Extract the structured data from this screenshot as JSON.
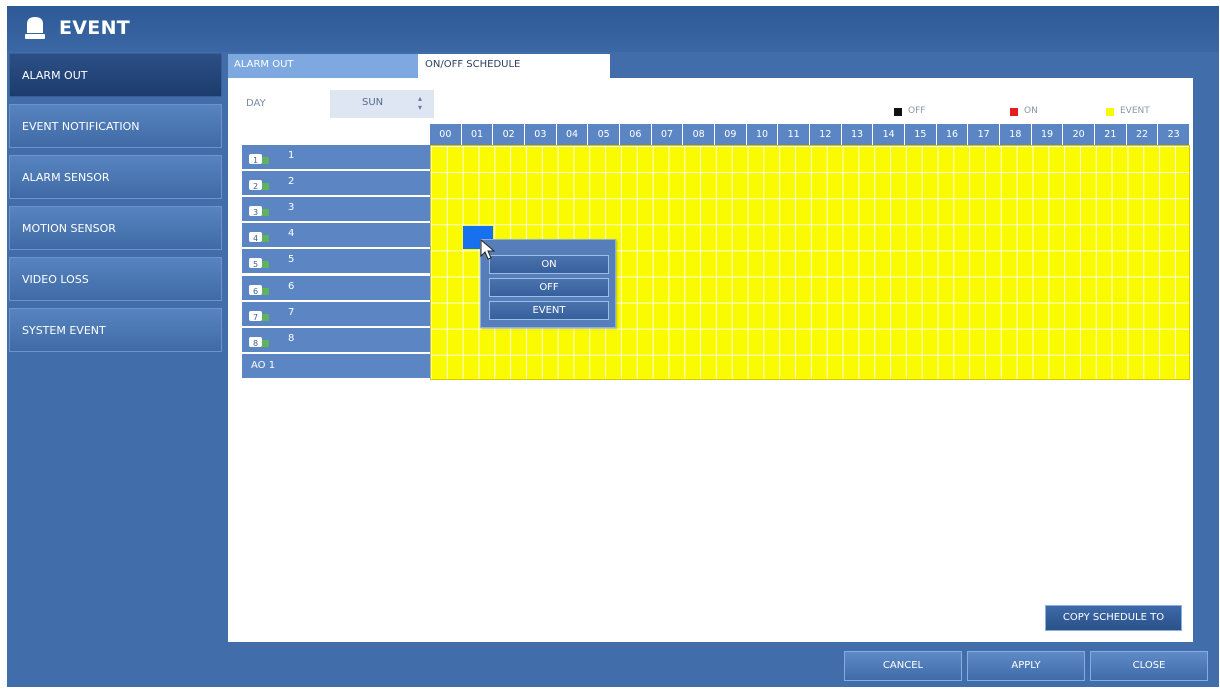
{
  "app": {
    "title": "EVENT"
  },
  "sidebar": {
    "items": [
      {
        "label": "ALARM OUT",
        "active": true
      },
      {
        "label": "EVENT NOTIFICATION",
        "active": false
      },
      {
        "label": "ALARM SENSOR",
        "active": false
      },
      {
        "label": "MOTION SENSOR",
        "active": false
      },
      {
        "label": "VIDEO LOSS",
        "active": false
      },
      {
        "label": "SYSTEM EVENT",
        "active": false
      }
    ]
  },
  "tabs": [
    {
      "label": "ALARM OUT",
      "active": false
    },
    {
      "label": "ON/OFF SCHEDULE",
      "active": true
    }
  ],
  "day": {
    "label": "DAY",
    "value": "SUN",
    "spinner": "▲▼"
  },
  "legend": [
    {
      "label": "OFF",
      "color": "#111111"
    },
    {
      "label": "ON",
      "color": "#e0201c"
    },
    {
      "label": "EVENT",
      "color": "#fafa00"
    }
  ],
  "hours": [
    "00",
    "01",
    "02",
    "03",
    "04",
    "05",
    "06",
    "07",
    "08",
    "09",
    "10",
    "11",
    "12",
    "13",
    "14",
    "15",
    "16",
    "17",
    "18",
    "19",
    "20",
    "21",
    "22",
    "23"
  ],
  "rows": [
    {
      "num": "1",
      "icon": "camera-icon"
    },
    {
      "num": "2",
      "icon": "camera-icon"
    },
    {
      "num": "3",
      "icon": "camera-icon"
    },
    {
      "num": "4",
      "icon": "camera-icon"
    },
    {
      "num": "5",
      "icon": "camera-icon"
    },
    {
      "num": "6",
      "icon": "camera-icon"
    },
    {
      "num": "7",
      "icon": "camera-icon"
    },
    {
      "num": "8",
      "icon": "camera-icon"
    },
    {
      "num": "AO 1",
      "icon": ""
    }
  ],
  "schedule": {
    "fill": "EVENT",
    "fill_color": "#fafa00",
    "selected_color": "#1770ee"
  },
  "context_menu": [
    "ON",
    "OFF",
    "EVENT"
  ],
  "buttons": {
    "copy": "COPY SCHEDULE TO",
    "cancel": "CANCEL",
    "apply": "APPLY",
    "close": "CLOSE"
  }
}
